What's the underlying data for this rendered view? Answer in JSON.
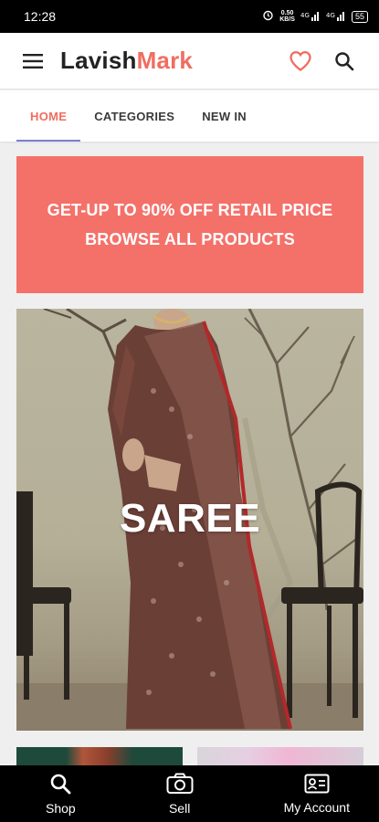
{
  "status": {
    "time": "12:28",
    "speed_value": "0.50",
    "speed_unit": "KB/S",
    "battery": "55"
  },
  "header": {
    "logo_part1": "Lavish",
    "logo_part2": "Mark"
  },
  "tabs": [
    {
      "label": "HOME",
      "active": true
    },
    {
      "label": "CATEGORIES",
      "active": false
    },
    {
      "label": "NEW IN",
      "active": false
    }
  ],
  "promo": {
    "line1": "GET-UP TO 90% OFF RETAIL PRICE",
    "line2": "BROWSE ALL PRODUCTS"
  },
  "category": {
    "label": "SAREE"
  },
  "bottom_nav": [
    {
      "label": "Shop",
      "icon": "search-icon"
    },
    {
      "label": "Sell",
      "icon": "camera-icon"
    },
    {
      "label": "My Account",
      "icon": "id-card-icon"
    }
  ],
  "colors": {
    "accent": "#f06d61",
    "promo_bg": "#f4716a",
    "tab_indicator": "#7b7fd1"
  }
}
